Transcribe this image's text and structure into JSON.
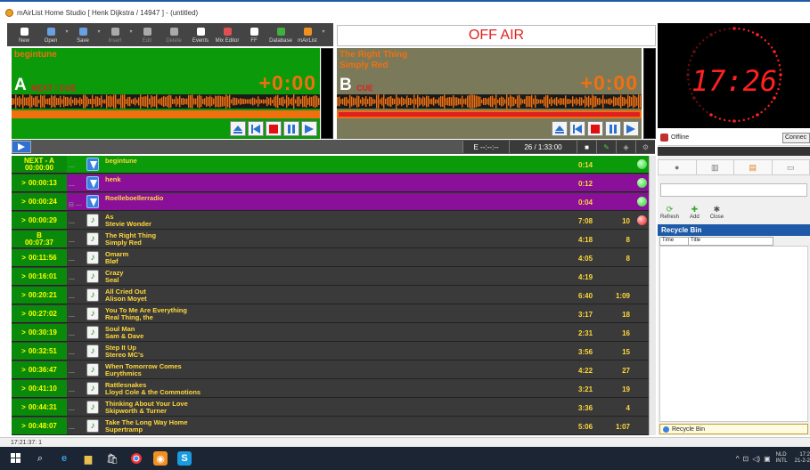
{
  "window": {
    "title": "mAirList Home Studio [ Henk Dijkstra / 14947 ] - (untitled)"
  },
  "toolbar": {
    "items": [
      {
        "label": "New",
        "icon": "new-icon",
        "color": "#ffffff"
      },
      {
        "label": "Open",
        "icon": "open-icon",
        "color": "#6aa0e0"
      },
      {
        "label": "Save",
        "icon": "save-icon",
        "color": "#6aa0e0"
      },
      {
        "label": "Insert",
        "icon": "insert-icon",
        "color": "#aaaaaa"
      },
      {
        "label": "Edit",
        "icon": "edit-icon",
        "color": "#aaaaaa"
      },
      {
        "label": "Delete",
        "icon": "delete-icon",
        "color": "#aaaaaa"
      },
      {
        "label": "Events",
        "icon": "events-icon",
        "color": "#ffffff"
      },
      {
        "label": "Mix Editor",
        "icon": "mix-editor-icon",
        "color": "#e05050"
      },
      {
        "label": "FF",
        "icon": "ff-icon",
        "color": "#ffffff"
      },
      {
        "label": "Database",
        "icon": "database-icon",
        "color": "#40b040"
      },
      {
        "label": "mAirList",
        "icon": "mairlist-icon",
        "color": "#f09020"
      }
    ]
  },
  "status": {
    "onair_label": "OFF AIR"
  },
  "clock": {
    "time": "17:26"
  },
  "playerA": {
    "letter": "A",
    "title": "begintune",
    "artist": "",
    "status": "NEXT / CUE",
    "time": "+0:00"
  },
  "playerB": {
    "letter": "B",
    "title": "The Right Thing",
    "artist": "Simply Red",
    "status": "CUE",
    "time": "+0:00"
  },
  "strip": {
    "end_time": "E --:--:--",
    "count": "26 / 1:33:00"
  },
  "playlist": {
    "rows": [
      {
        "time": "NEXT - A\n00:00:00",
        "title": "begintune",
        "artist": "",
        "duration": "0:14",
        "extra": "",
        "type": "jingle",
        "bg": "green",
        "dot": "g"
      },
      {
        "time": "00:00:13",
        "title": "henk",
        "artist": "",
        "duration": "0:12",
        "extra": "",
        "type": "jingle",
        "bg": "purple",
        "dot": "g"
      },
      {
        "time": "00:00:24",
        "title": "Roelleboellerradio",
        "artist": "",
        "duration": "0:04",
        "extra": "",
        "type": "jingle",
        "bg": "purple",
        "dot": "g"
      },
      {
        "time": "00:00:29",
        "title": "As",
        "artist": "Stevie Wonder",
        "duration": "7:08",
        "extra": "10",
        "type": "music",
        "bg": "",
        "dot": "r"
      },
      {
        "time": "B\n00:07:37",
        "title": "The Right Thing",
        "artist": "Simply Red",
        "duration": "4:18",
        "extra": "8",
        "type": "music",
        "bg": "",
        "dot": ""
      },
      {
        "time": "00:11:56",
        "title": "Omarm",
        "artist": "Bløf",
        "duration": "4:05",
        "extra": "8",
        "type": "music",
        "bg": "",
        "dot": ""
      },
      {
        "time": "00:16:01",
        "title": "Crazy",
        "artist": "Seal",
        "duration": "4:19",
        "extra": "",
        "type": "music",
        "bg": "",
        "dot": ""
      },
      {
        "time": "00:20:21",
        "title": "All Cried Out",
        "artist": "Alison Moyet",
        "duration": "6:40",
        "extra": "1:09",
        "type": "music",
        "bg": "",
        "dot": ""
      },
      {
        "time": "00:27:02",
        "title": "You To Me Are Everything",
        "artist": "Real Thing, the",
        "duration": "3:17",
        "extra": "18",
        "type": "music",
        "bg": "",
        "dot": ""
      },
      {
        "time": "00:30:19",
        "title": "Soul Man",
        "artist": "Sam & Dave",
        "duration": "2:31",
        "extra": "16",
        "type": "music",
        "bg": "",
        "dot": ""
      },
      {
        "time": "00:32:51",
        "title": "Step It Up",
        "artist": "Stereo MC's",
        "duration": "3:56",
        "extra": "15",
        "type": "music",
        "bg": "",
        "dot": ""
      },
      {
        "time": "00:36:47",
        "title": "When Tomorrow Comes",
        "artist": "Eurythmics",
        "duration": "4:22",
        "extra": "27",
        "type": "music",
        "bg": "",
        "dot": ""
      },
      {
        "time": "00:41:10",
        "title": "Rattlesnakes",
        "artist": "Lloyd Cole & the Commotions",
        "duration": "3:21",
        "extra": "19",
        "type": "music",
        "bg": "",
        "dot": ""
      },
      {
        "time": "00:44:31",
        "title": "Thinking About Your Love",
        "artist": "Skipworth & Turner",
        "duration": "3:36",
        "extra": "4",
        "type": "music",
        "bg": "",
        "dot": ""
      },
      {
        "time": "00:48:07",
        "title": "Take The Long Way Home",
        "artist": "Supertramp",
        "duration": "5:06",
        "extra": "1:07",
        "type": "music",
        "bg": "",
        "dot": ""
      }
    ]
  },
  "side": {
    "offline_label": "Offline",
    "connect_label": "Connec",
    "refresh_label": "Refresh",
    "add_label": "Add",
    "close_label": "Close",
    "recycle_title": "Recycle Bin",
    "col_time": "Time",
    "col_title": "Title",
    "bottom_tab": "Recycle Bin"
  },
  "statusbar": {
    "text": "17:21:37: 1"
  },
  "tray": {
    "lang1": "NLD",
    "lang2": "INTL",
    "time": "17:2",
    "date": "21-2-2"
  }
}
